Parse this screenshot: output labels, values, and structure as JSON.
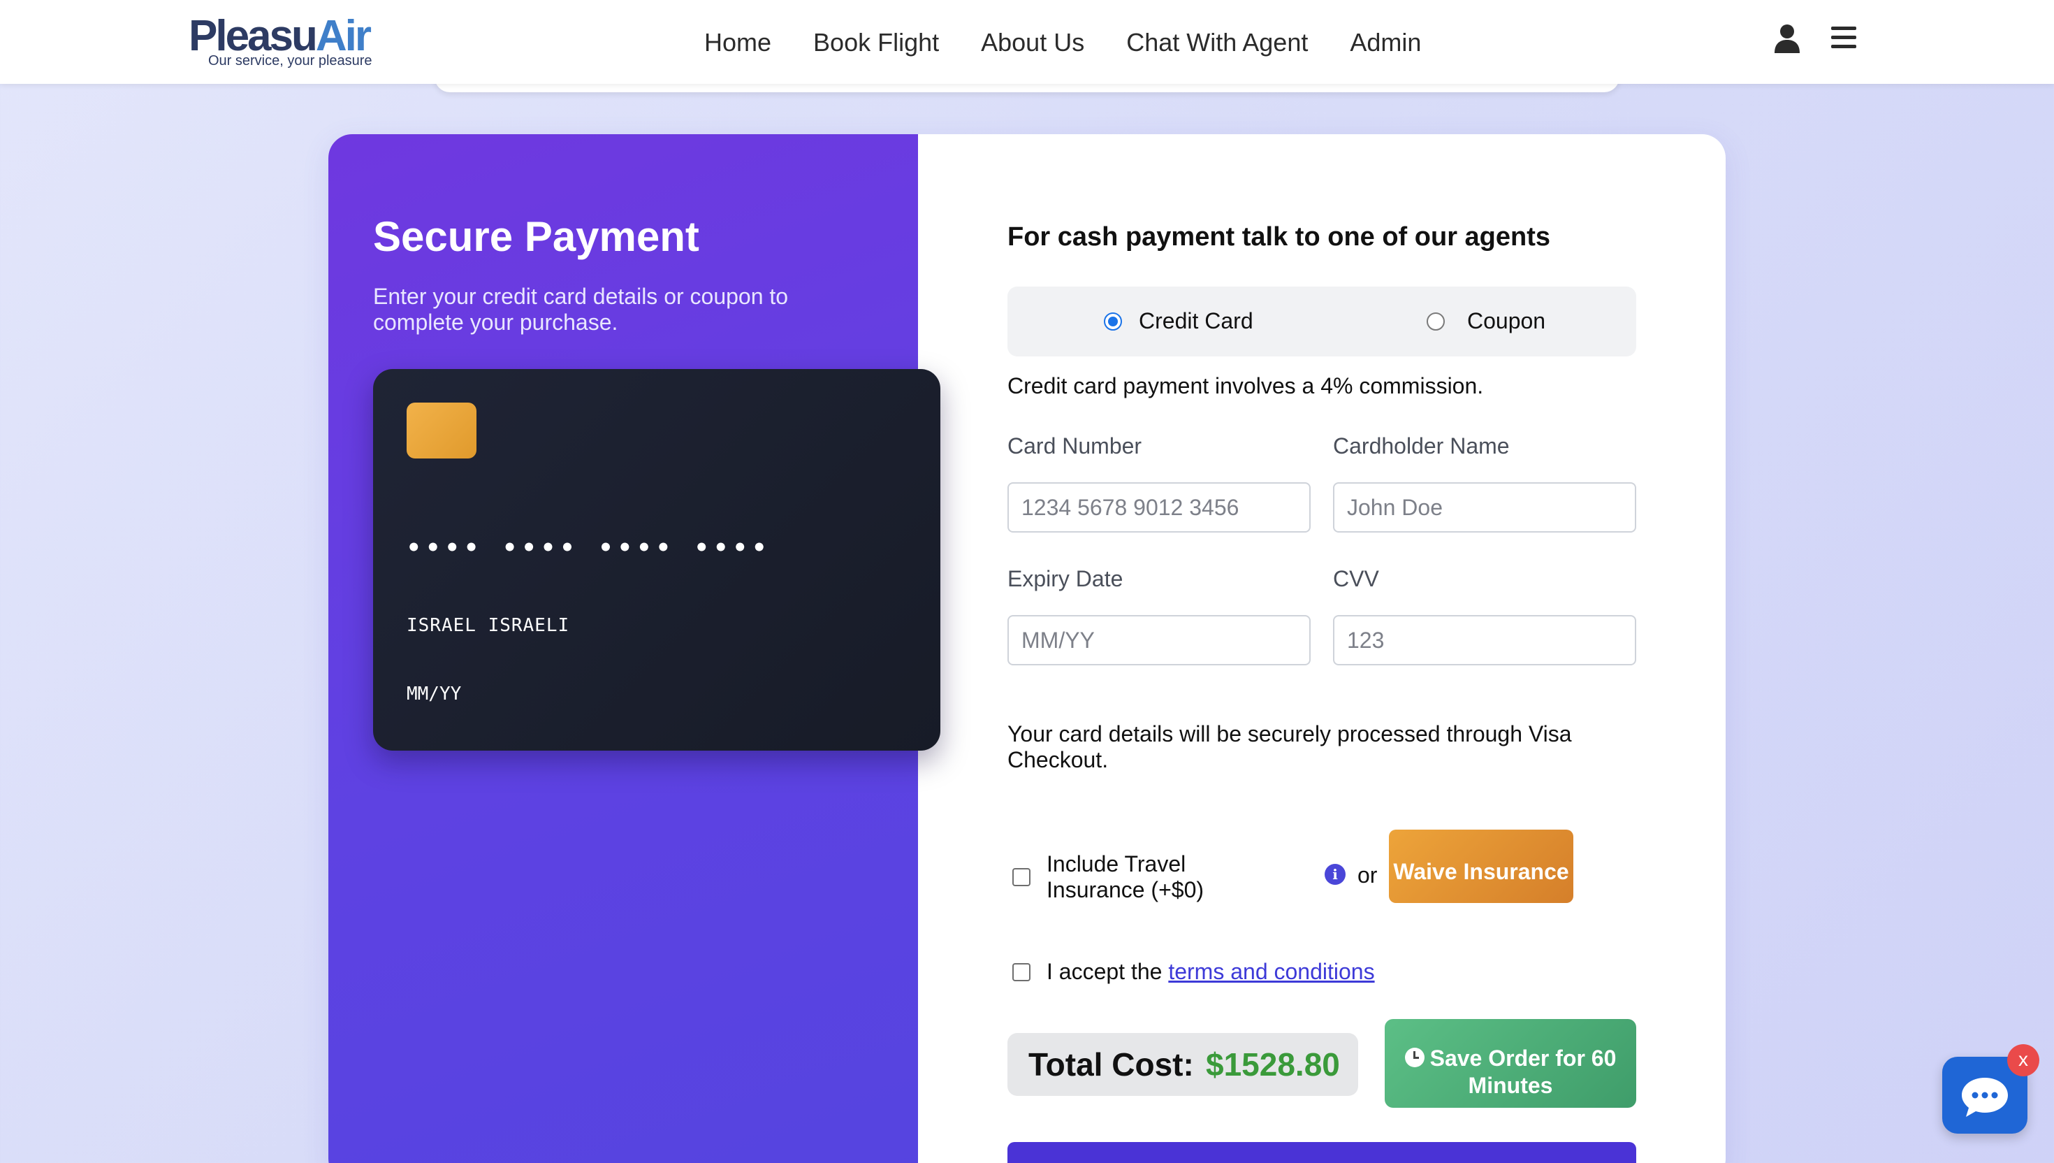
{
  "brand": {
    "name_part1": "Pleasu",
    "name_part2": "Air",
    "tagline": "Our service, your pleasure"
  },
  "nav": {
    "links": [
      "Home",
      "Book Flight",
      "About Us",
      "Chat With Agent",
      "Admin"
    ]
  },
  "left": {
    "title": "Secure Payment",
    "subtitle": "Enter your credit card details or coupon to complete your purchase.",
    "card": {
      "number": "•••• •••• •••• ••••",
      "holder": "ISRAEL ISRAELI",
      "expiry": "MM/YY"
    }
  },
  "form": {
    "cash_note": "For cash payment talk to one of our agents",
    "methods": [
      {
        "label": "Credit Card",
        "selected": true
      },
      {
        "label": "Coupon",
        "selected": false
      }
    ],
    "commission_note": "Credit card payment involves a 4% commission.",
    "fields": {
      "card_number": {
        "label": "Card Number",
        "placeholder": "1234 5678 9012 3456",
        "value": ""
      },
      "cardholder": {
        "label": "Cardholder Name",
        "placeholder": "John Doe",
        "value": ""
      },
      "expiry": {
        "label": "Expiry Date",
        "placeholder": "MM/YY",
        "value": ""
      },
      "cvv": {
        "label": "CVV",
        "placeholder": "123",
        "value": ""
      }
    },
    "secure_note": "Your card details will be securely processed through Visa Checkout.",
    "insurance": {
      "label": "Include Travel Insurance (+$0)",
      "checked": false,
      "or_text": "or",
      "waive_label": "Waive Insurance"
    },
    "terms": {
      "prefix": "I accept the ",
      "link": "terms and conditions",
      "checked": false
    },
    "total": {
      "label": "Total Cost:",
      "value": "$1528.80"
    },
    "save_order_label": "Save Order for 60 Minutes"
  },
  "chat": {
    "close_label": "x"
  },
  "colors": {
    "accent_purple": "#6f38e0",
    "total_green": "#3a9a3a",
    "waive_orange": "#eda43a",
    "save_green": "#4fb07a",
    "chat_blue": "#1f66d6"
  },
  "icons": [
    "user-icon",
    "menu-icon",
    "info-icon",
    "clock-icon",
    "chat-icon"
  ]
}
